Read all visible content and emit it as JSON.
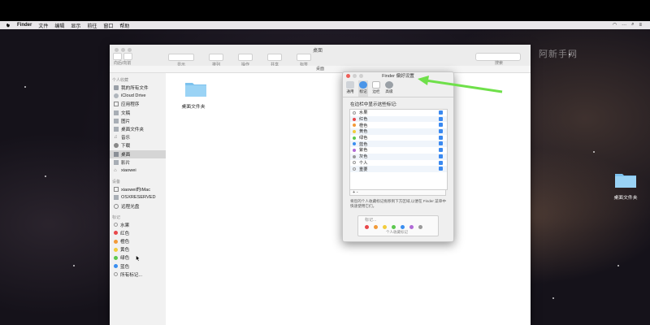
{
  "menubar": {
    "items": [
      "Finder",
      "文件",
      "编辑",
      "显示",
      "前往",
      "窗口",
      "帮助"
    ],
    "right_status": "···"
  },
  "finder": {
    "title": "桌面",
    "back_forward_label": "向后/向前",
    "toolbar": [
      "显示",
      "排列",
      "操作",
      "共享",
      "标签"
    ],
    "search_label": "搜索",
    "path": "桌面",
    "sidebar": {
      "favorites_head": "个人收藏",
      "favorites": [
        "我的所有文件",
        "iCloud Drive",
        "应用程序",
        "文稿",
        "图片",
        "桌面文件夹",
        "音乐",
        "下载",
        "桌面",
        "影片",
        "xiaowei"
      ],
      "devices_head": "设备",
      "devices": [
        "xiaowei的iMac",
        "OSXRESERVED",
        "远程光盘"
      ],
      "tags_head": "标记",
      "tags": [
        "水果",
        "红色",
        "橙色",
        "黄色",
        "绿色",
        "蓝色",
        "所有标记..."
      ]
    },
    "content_folder_label": "桌面文件夹"
  },
  "prefs": {
    "title": "Finder 偏好设置",
    "tabs": [
      "通用",
      "标记",
      "边栏",
      "高级"
    ],
    "subheading": "在边栏中显示这些标记:",
    "tags": [
      {
        "name": "水果",
        "color": "#ffffff"
      },
      {
        "name": "红色",
        "color": "#e8474a"
      },
      {
        "name": "橙色",
        "color": "#f29a38"
      },
      {
        "name": "黄色",
        "color": "#f2cc3c"
      },
      {
        "name": "绿色",
        "color": "#5cc84e"
      },
      {
        "name": "蓝色",
        "color": "#3a8ef0"
      },
      {
        "name": "紫色",
        "color": "#b06ad6"
      },
      {
        "name": "灰色",
        "color": "#9a9a9a"
      },
      {
        "name": "个人",
        "color": "#ffffff"
      },
      {
        "name": "重要",
        "color": "#ffffff"
      }
    ],
    "add_label": "+ -",
    "description": "将您的个人收藏标记拖移到下方区域,以便在 Finder 菜单中快速使用它们。",
    "drop_hint": "标记...",
    "drop_caption": "个人收藏标记",
    "drop_colors": [
      "#e8474a",
      "#f29a38",
      "#f2cc3c",
      "#5cc84e",
      "#3a8ef0",
      "#b06ad6",
      "#9a9a9a"
    ]
  },
  "desktop": {
    "folder_label": "桌面文件夹",
    "watermark": "阿新手网"
  }
}
